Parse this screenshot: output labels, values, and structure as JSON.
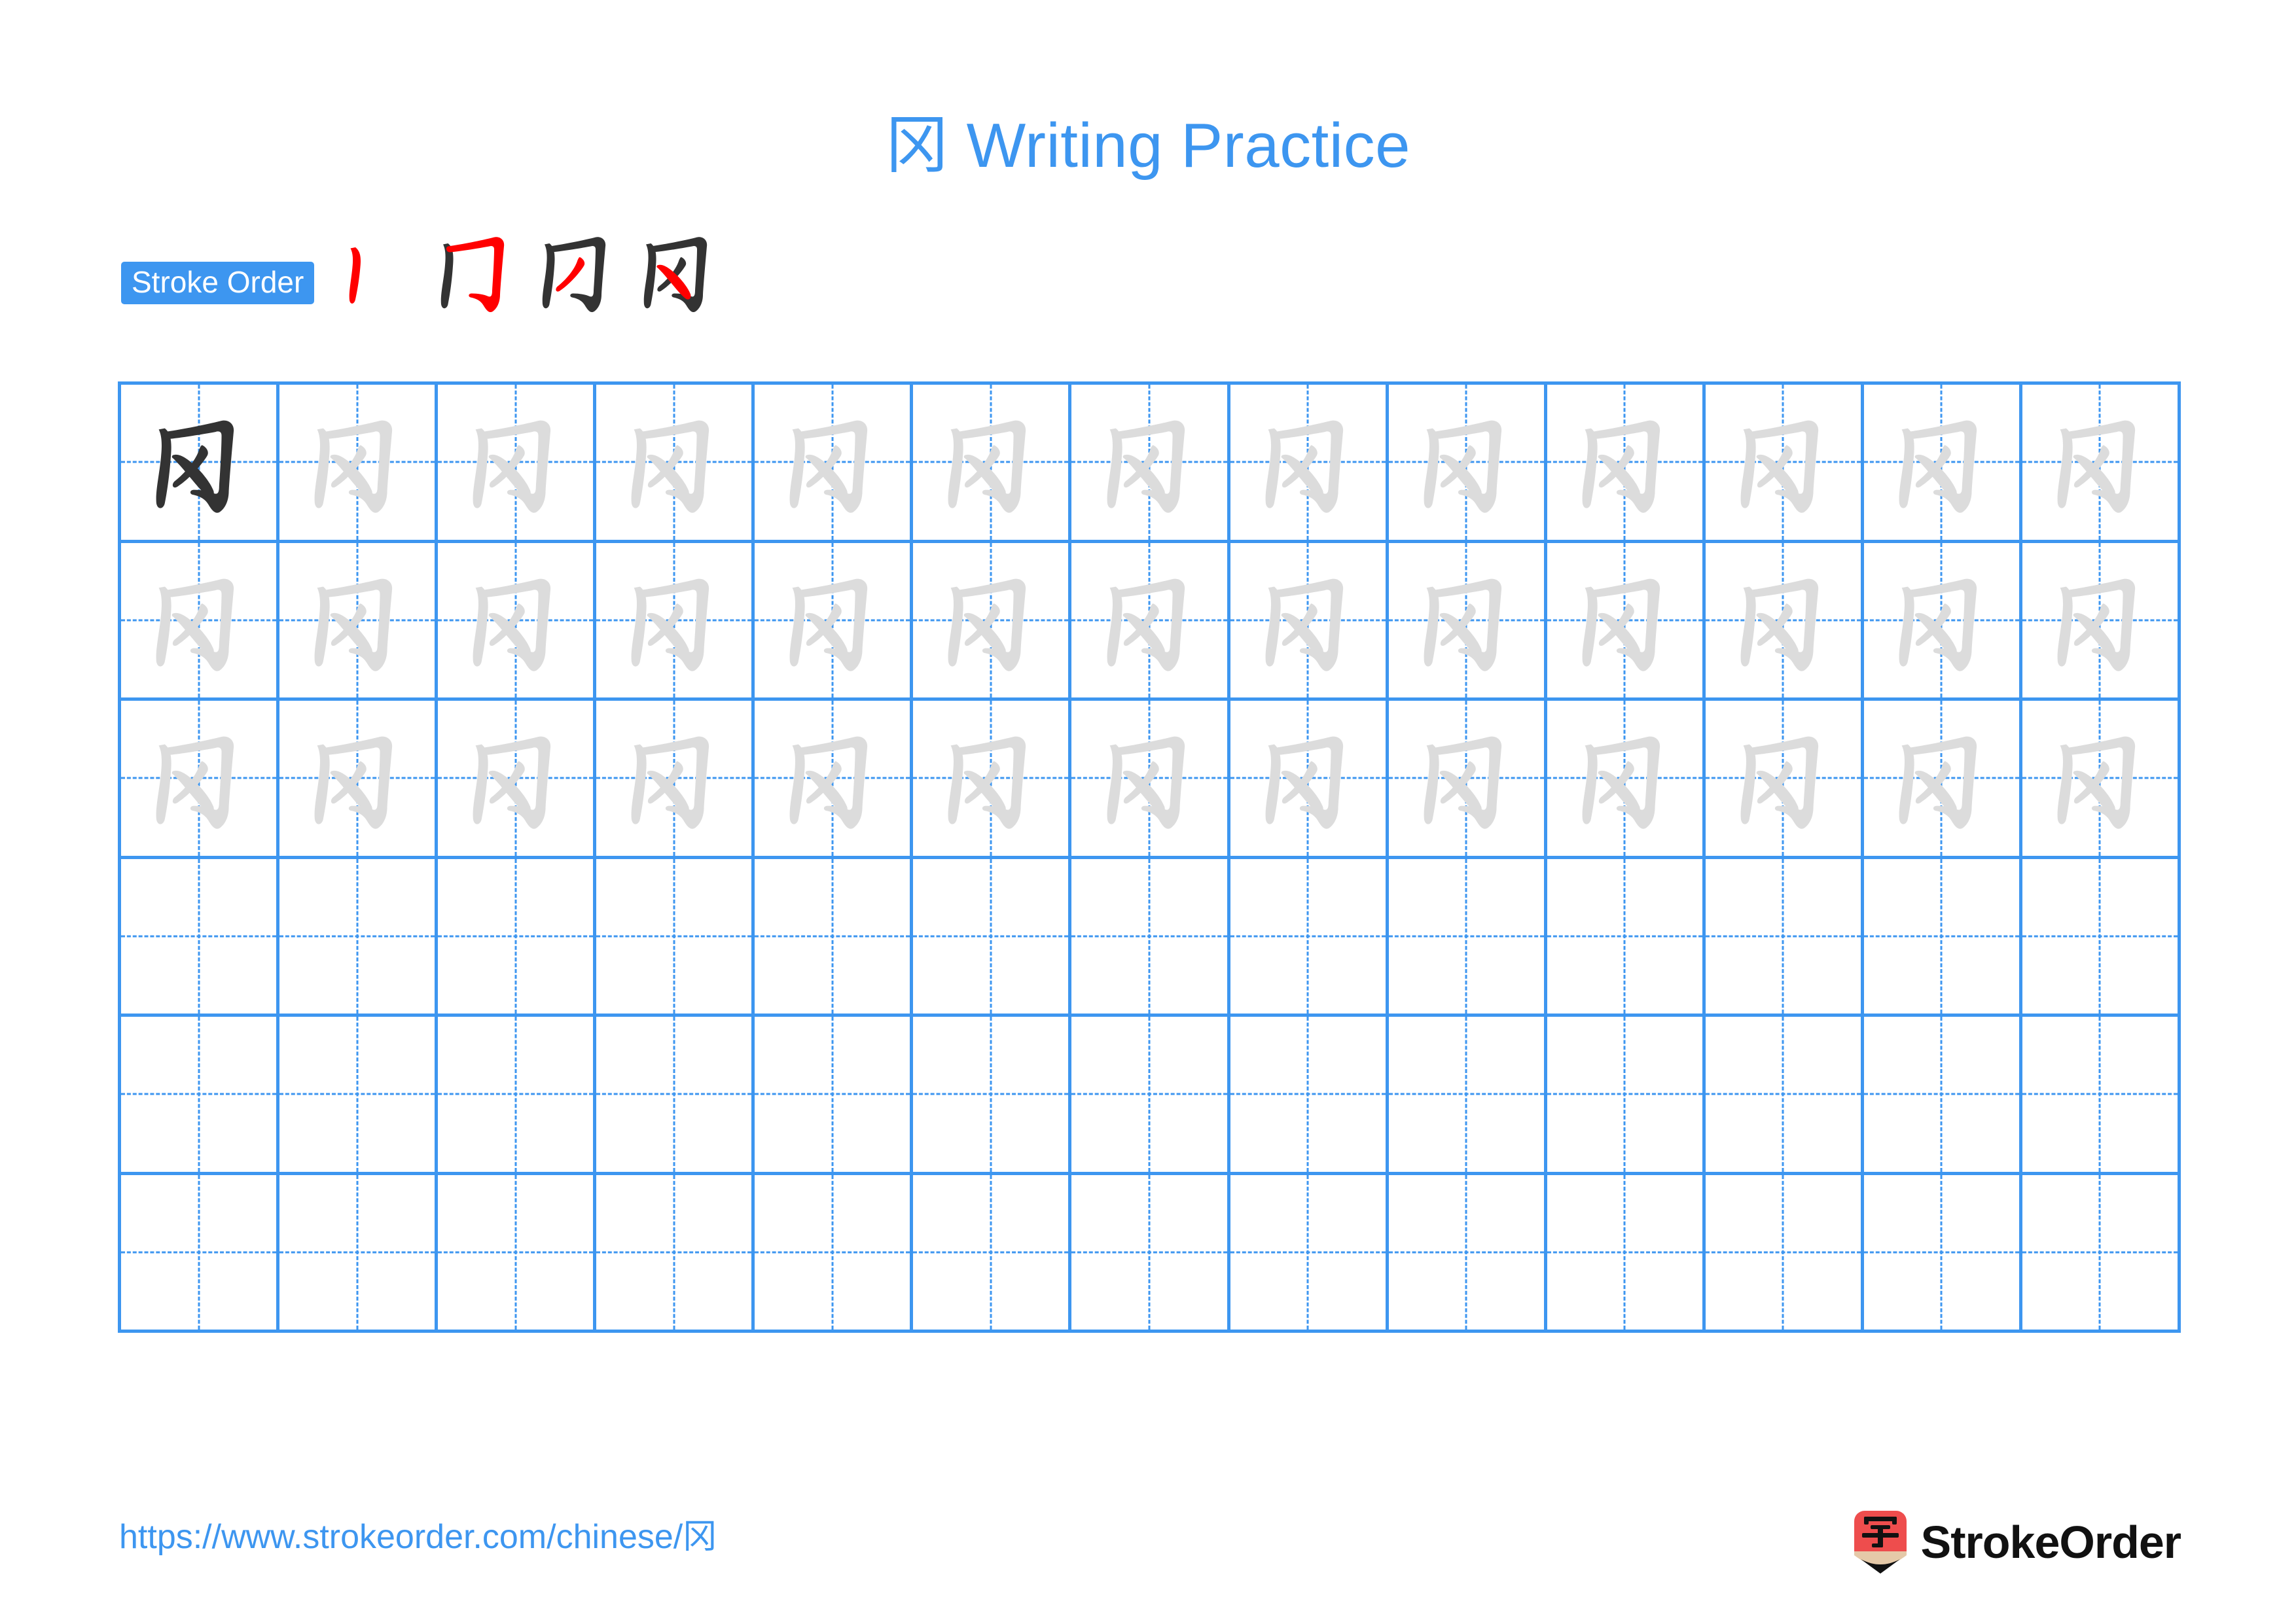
{
  "character": "冈",
  "title": "冈 Writing Practice",
  "colors": {
    "accent_blue": "#3d96f0",
    "grid_line": "#3d96f0",
    "trace_gray": "#dcdcdc",
    "ink_black": "#333333",
    "stroke_highlight_red": "#ff0000",
    "logo_red": "#ee4d4d",
    "logo_wood": "#e5c9a8"
  },
  "stroke_order": {
    "label": "Stroke Order",
    "stroke_count": 4,
    "steps": [
      {
        "index": 1,
        "new_stroke": "丨",
        "name": "shu"
      },
      {
        "index": 2,
        "new_stroke": "𠃌",
        "name": "heng-zhe-gou"
      },
      {
        "index": 3,
        "new_stroke": "丿",
        "name": "pie"
      },
      {
        "index": 4,
        "new_stroke": "㇏",
        "name": "na"
      }
    ]
  },
  "practice_grid": {
    "columns": 13,
    "rows": 6,
    "rows_detail": [
      {
        "row": 1,
        "first_cell_style": "solid-dark",
        "other_cells_style": "trace-gray",
        "filled": true
      },
      {
        "row": 2,
        "first_cell_style": "trace-gray",
        "other_cells_style": "trace-gray",
        "filled": true
      },
      {
        "row": 3,
        "first_cell_style": "trace-gray",
        "other_cells_style": "trace-gray",
        "filled": true
      },
      {
        "row": 4,
        "first_cell_style": "empty",
        "other_cells_style": "empty",
        "filled": false
      },
      {
        "row": 5,
        "first_cell_style": "empty",
        "other_cells_style": "empty",
        "filled": false
      },
      {
        "row": 6,
        "first_cell_style": "empty",
        "other_cells_style": "empty",
        "filled": false
      }
    ]
  },
  "footer": {
    "url": "https://www.strokeorder.com/chinese/冈",
    "brand_name": "StrokeOrder",
    "brand_mark_character": "字"
  }
}
